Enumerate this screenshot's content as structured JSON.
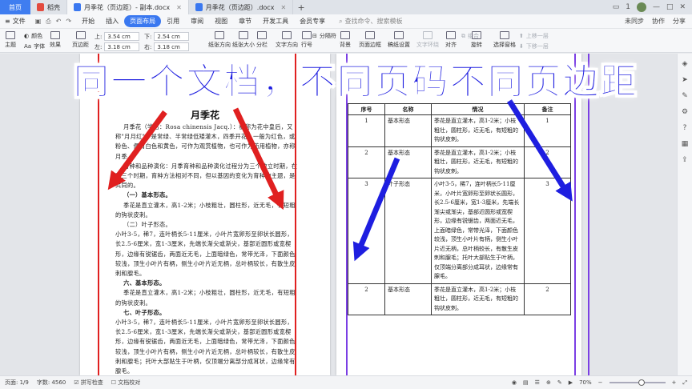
{
  "titlebar": {
    "home": "首页",
    "tabs": [
      {
        "label": "稻壳",
        "icon": "daoke-icon",
        "active": false
      },
      {
        "label": "月季花（页边距）- 副本.docx",
        "icon": "wps-doc-icon",
        "active": true
      },
      {
        "label": "月季花（页边距）.docx",
        "icon": "wps-doc-icon",
        "active": false
      }
    ],
    "add": "+",
    "right": {
      "count": "1",
      "user": "avatar"
    }
  },
  "menubar": {
    "file": "文件",
    "items": [
      "开始",
      "插入",
      "页面布局",
      "引用",
      "审阅",
      "视图",
      "章节",
      "开发工具",
      "会员专享"
    ],
    "active": "页面布局",
    "search": "查找命令、搜索模板",
    "right": [
      "未同步",
      "协作",
      "分享"
    ]
  },
  "ribbon": {
    "theme": "主题",
    "colors": "颜色",
    "fonts": "字体",
    "effects": "效果",
    "margin_btn": "页边距",
    "top_label": "上:",
    "top_value": "3.54 cm",
    "bottom_label": "下:",
    "bottom_value": "2.54 cm",
    "left_label": "左:",
    "left_value": "3.18 cm",
    "right_label": "右:",
    "right_value": "3.18 cm",
    "orientation": "纸张方向",
    "size": "纸张大小",
    "columns": "分栏",
    "text_dir": "文字方向",
    "line_no": "行号",
    "breaks": "分隔符",
    "background": "背景",
    "page_border": "页面边框",
    "paper_setup": "稿纸设置",
    "text_wrap": "文字环绕",
    "align": "对齐",
    "rotate": "旋转",
    "select_pane": "选择窗格",
    "group": "组合",
    "bring_forward": "上移一层",
    "send_backward": "下移一层"
  },
  "banner": "同一个文档，不同页码不同页边距",
  "left_page": {
    "title": "月季花",
    "paragraphs": [
      {
        "text": "月季花（学名：Rosa chinensis Jacq.）：被称为花中皇后，又称\"月月红\"，是常绿、半常绿低矮灌木，四季开花，一般为红色，或粉色、偶有白色和黄色，可作为观赏植物，也可作为药用植物，亦称月季。",
        "cls": "ind"
      },
      {
        "text": "育种和品种演化：月季育种和品种演化过程分为三个独立时期，在这三个时期，育种方法相对不同，但以基因的变化为育种的主题，是共同的。",
        "cls": "ind"
      },
      {
        "text": "（一）基本形态。",
        "cls": "h ind"
      },
      {
        "text": "季花是直立灌木，高1-2米；小枝粗壮，圆柱形，近无毛，有短粗的钩状皮刺。",
        "cls": "ind"
      },
      {
        "text": "（二）叶子形态。",
        "cls": "ind"
      },
      {
        "text": "小叶3-5，稀7，连叶柄长5-11厘米，小叶片宽卵形至卵状长圆形，长2.5-6厘米，宽1-3厘米，先端长渐尖或渐尖，基部近圆形或宽楔形，边缘有锐锯齿，两面近无毛，上面暗绿色，常带光泽，下面颜色较浅，顶生小叶片有柄，侧生小叶片近无柄，总叶柄较长，有散生皮刺和腺毛。",
        "cls": ""
      },
      {
        "text": "六、基本形态。",
        "cls": "h ind"
      },
      {
        "text": "季花是直立灌木，高1-2米；小枝粗壮，圆柱形，近无毛，有短粗的钩状皮刺。",
        "cls": "ind"
      },
      {
        "text": "七、叶子形态。",
        "cls": "h ind"
      },
      {
        "text": "小叶3-5，稀7，连叶柄长5-11厘米，小叶片宽卵形至卵状长圆形，长2.5-6厘米，宽1-3厘米，先端长渐尖或渐尖，基部近圆形或宽楔形，边缘有锐锯齿，两面近无毛，上面暗绿色，常带光泽，下面颜色较浅，顶生小叶片有柄，侧生小叶片近无柄，总叶柄较长，有散生皮刺和腺毛；托叶大部贴生于叶柄，仅顶端分离部分成耳状，边缘常有腺毛。",
        "cls": ""
      }
    ]
  },
  "right_page": {
    "headers": [
      "序号",
      "名称",
      "情况",
      "备注"
    ],
    "rows": [
      {
        "no": "1",
        "name": "基本形态",
        "desc": "季花是直立灌木，高1-2米；小枝粗壮，圆柱形，近无毛，有短粗的钩状皮刺。",
        "note": "1"
      },
      {
        "no": "2",
        "name": "基本形态",
        "desc": "季花是直立灌木，高1-2米；小枝粗壮，圆柱形，近无毛，有短粗的钩状皮刺。",
        "note": "2"
      },
      {
        "no": "3",
        "name": "叶子形态",
        "desc": "小叶3-5，稀7，连叶柄长5-11厘米，小叶片宽卵形至卵状长圆形，长2.5-6厘米，宽1-3厘米，先端长渐尖或渐尖，基部近圆形或宽楔形，边缘有锐锯齿，两面近无毛，上面暗绿色，常带光泽，下面颜色较浅，顶生小叶片有柄，侧生小叶片近无柄，总叶柄较长，有散生皮刺和腺毛；托叶大部贴生于叶柄，仅顶端分离部分成耳状，边缘常有腺毛。",
        "note": "3"
      },
      {
        "no": "2",
        "name": "基本形态",
        "desc": "季花是直立灌木，高1-2米；小枝粗壮，圆柱形，近无毛，有短粗的钩状皮刺。",
        "note": "2"
      }
    ]
  },
  "status": {
    "page": "页面: 1/9",
    "words": "字数: 4560",
    "spell": "拼写检查",
    "proof": "文档校对",
    "zoom": "70%"
  },
  "colors": {
    "arrow_red": "#e02020",
    "arrow_blue": "#1e1ee0",
    "line_purple": "#7b3fe4",
    "accent": "#3a78f0"
  }
}
